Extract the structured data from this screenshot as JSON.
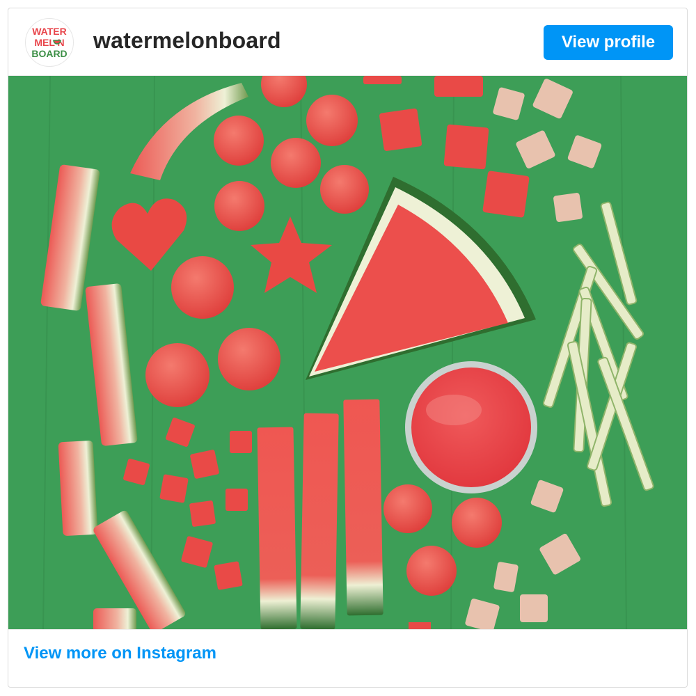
{
  "post": {
    "account": {
      "username": "watermelonboard",
      "avatar_logo_text": [
        "WATER",
        "MEL N",
        "BOARD"
      ]
    },
    "view_profile_label": "View profile",
    "photo": {
      "icon": "watermelon-arrangement-photo"
    },
    "view_more_label": "View more on Instagram"
  },
  "colors": {
    "accent": "#0095f6",
    "username": "#262626",
    "border": "#dbdbdb",
    "photo_background": "#3d9e57",
    "watermelon_flesh": "#ef5a55",
    "rind_green": "#2f6e2f",
    "rind_white": "#e9eed2",
    "logo_red": "#e8454b",
    "logo_green": "#3c8f46"
  }
}
